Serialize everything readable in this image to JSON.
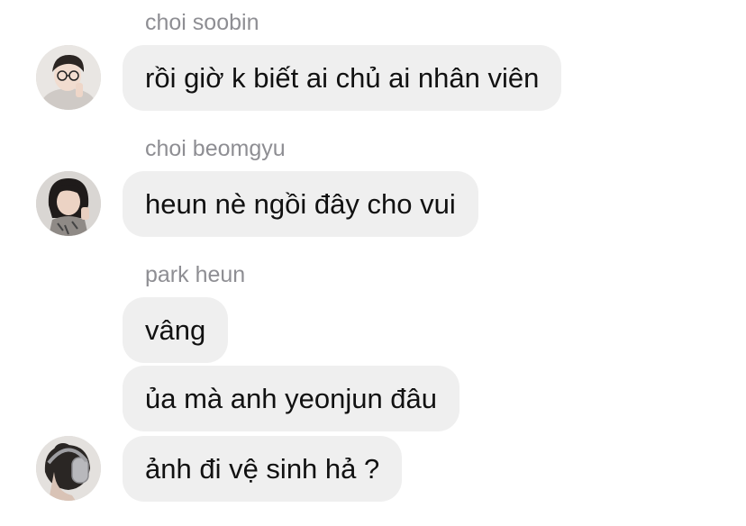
{
  "messages": [
    {
      "sender": "choi soobin",
      "bubbles": [
        "rồi giờ k biết ai chủ ai nhân viên"
      ]
    },
    {
      "sender": "choi beomgyu",
      "bubbles": [
        "heun nè ngồi đây cho vui"
      ]
    },
    {
      "sender": "park heun",
      "bubbles": [
        "vâng",
        "ủa mà anh yeonjun đâu",
        "ảnh đi vệ sinh hả ?"
      ]
    }
  ],
  "colors": {
    "bubble_bg": "#efefef",
    "sender_text": "#8e8e93",
    "message_text": "#111111"
  },
  "avatars": [
    "avatar-soobin",
    "avatar-beomgyu",
    "avatar-heun"
  ]
}
